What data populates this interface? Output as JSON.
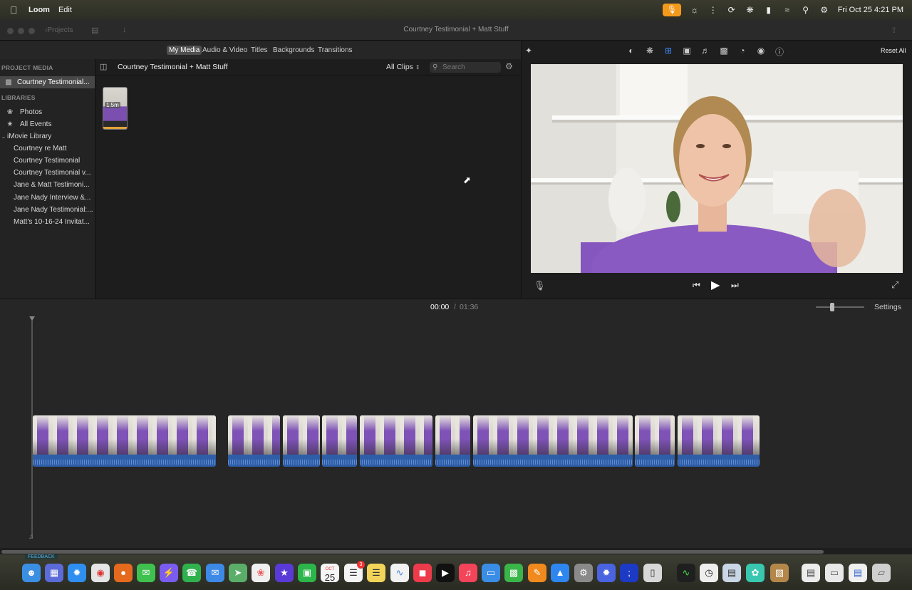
{
  "menubar": {
    "app_name": "Loom",
    "menu_edit": "Edit",
    "clock": "Fri Oct 25  4:21 PM"
  },
  "window": {
    "back_label": "Projects",
    "title": "Courtney Testimonial + Matt Stuff"
  },
  "media_tabs": {
    "my_media": "My Media",
    "audio_video": "Audio & Video",
    "titles": "Titles",
    "backgrounds": "Backgrounds",
    "transitions": "Transitions"
  },
  "sidebar": {
    "project_media_header": "PROJECT MEDIA",
    "project_item": "Courtney Testimonial...",
    "libraries_header": "LIBRARIES",
    "photos": "Photos",
    "all_events": "All Events",
    "library_name": "iMovie Library",
    "events": [
      "Courtney re Matt",
      "Courtney Testimonial",
      "Courtney Testimonial v...",
      "Jane & Matt Testimoni...",
      "Jane Nady Interview &...",
      "Jane Nady Testimonial:...",
      "Matt's 10-16-24 Invitat..."
    ]
  },
  "browser": {
    "title": "Courtney Testimonial + Matt Stuff",
    "filter": "All Clips",
    "search_placeholder": "Search",
    "clip_duration": "1.5m"
  },
  "viewer": {
    "reset_all": "Reset All"
  },
  "timeline": {
    "current_time": "00:00",
    "separator": "/",
    "total_time": "01:36",
    "settings": "Settings"
  },
  "dock": {
    "calendar_month": "OCT",
    "calendar_day": "25",
    "reminders_badge": "3",
    "feedback_label": "FEEDBACK"
  }
}
